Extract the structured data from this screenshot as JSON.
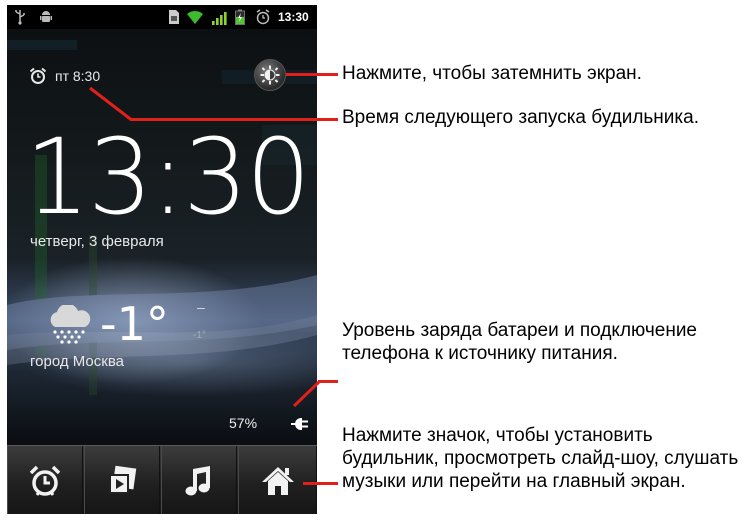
{
  "status_bar": {
    "time": "13:30",
    "icons": [
      "usb-icon",
      "android-debug-icon",
      "sim-icon",
      "wifi-icon",
      "signal-icon",
      "battery-charging-icon",
      "alarm-icon"
    ]
  },
  "clock": {
    "next_alarm": "пт 8:30",
    "time": "13:30",
    "date": "четверг, 3 февраля"
  },
  "weather": {
    "icon": "snow-cloud-icon",
    "temperature": "-1°",
    "high": "–",
    "low": "-1°",
    "city": "город Москва"
  },
  "battery": {
    "level": "57%",
    "level_value": 0.57
  },
  "dock": {
    "buttons": [
      {
        "name": "alarm-dock-button",
        "icon": "alarm-clock-icon"
      },
      {
        "name": "slideshow-dock-button",
        "icon": "gallery-icon"
      },
      {
        "name": "music-dock-button",
        "icon": "music-note-icon"
      },
      {
        "name": "home-dock-button",
        "icon": "home-icon"
      }
    ]
  },
  "annotations": {
    "dim_screen": "Нажмите, чтобы затемнить экран.",
    "next_alarm": "Время следующего запуска будильника.",
    "battery": "Уровень заряда батареи и подключение телефона к источнику питания.",
    "dock": "Нажмите значок, чтобы установить будильник, просмотреть слайд-шоу, слушать музыки или перейти на главный экран."
  },
  "colors": {
    "leader_line": "#e0201a",
    "wifi": "#3dbb2f",
    "signal": "#8bd42a",
    "battery": "#56c235"
  }
}
